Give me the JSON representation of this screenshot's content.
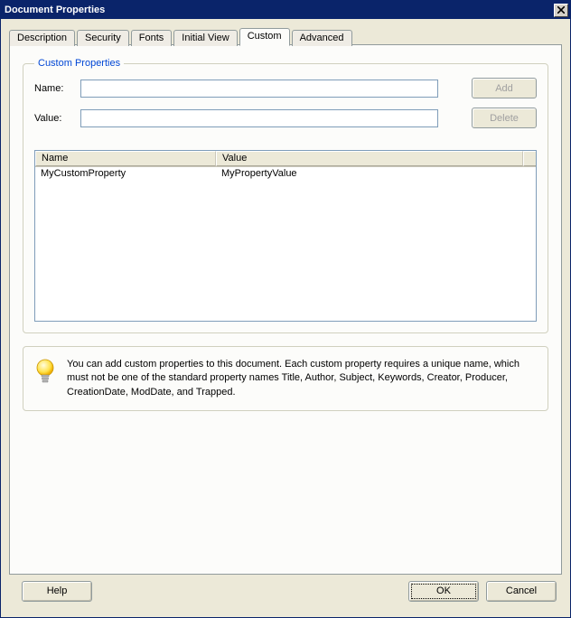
{
  "window": {
    "title": "Document Properties"
  },
  "tabs": {
    "items": [
      {
        "label": "Description"
      },
      {
        "label": "Security"
      },
      {
        "label": "Fonts"
      },
      {
        "label": "Initial View"
      },
      {
        "label": "Custom"
      },
      {
        "label": "Advanced"
      }
    ],
    "active_index": 4
  },
  "customPanel": {
    "groupLegend": "Custom Properties",
    "nameLabel": "Name:",
    "valueLabel": "Value:",
    "nameValue": "",
    "valueValue": "",
    "addLabel": "Add",
    "deleteLabel": "Delete",
    "columns": {
      "name": "Name",
      "value": "Value"
    },
    "rows": [
      {
        "name": "MyCustomProperty",
        "value": "MyPropertyValue"
      }
    ],
    "infoText": "You can add custom properties to this document. Each custom property requires a unique name, which must not be one of the standard property names Title, Author, Subject, Keywords, Creator, Producer, CreationDate, ModDate, and Trapped."
  },
  "buttons": {
    "help": "Help",
    "ok": "OK",
    "cancel": "Cancel"
  }
}
